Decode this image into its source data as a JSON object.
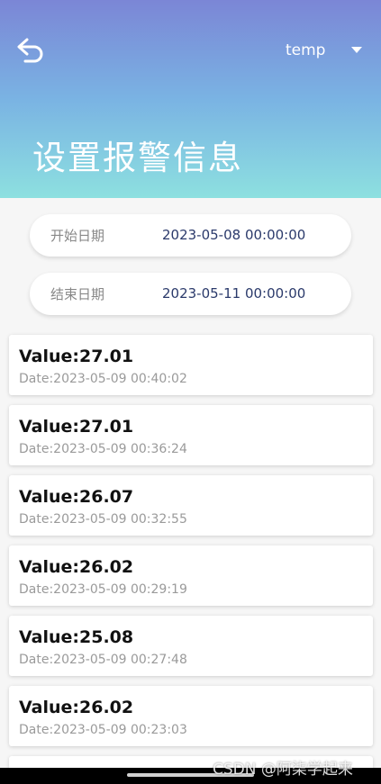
{
  "header": {
    "dropdown_value": "temp",
    "title": "设置报警信息"
  },
  "filters": {
    "start": {
      "label": "开始日期",
      "value": "2023-05-08 00:00:00"
    },
    "end": {
      "label": "结束日期",
      "value": "2023-05-11 00:00:00"
    }
  },
  "records": [
    {
      "value": "Value:27.01",
      "date": "Date:2023-05-09 00:40:02"
    },
    {
      "value": "Value:27.01",
      "date": "Date:2023-05-09 00:36:24"
    },
    {
      "value": "Value:26.07",
      "date": "Date:2023-05-09 00:32:55"
    },
    {
      "value": "Value:26.02",
      "date": "Date:2023-05-09 00:29:19"
    },
    {
      "value": "Value:25.08",
      "date": "Date:2023-05-09 00:27:48"
    },
    {
      "value": "Value:26.02",
      "date": "Date:2023-05-09 00:23:03"
    }
  ],
  "watermark": "CSDN @阿柒学起来",
  "icons": {
    "back": "back-arrow-icon",
    "dropdown": "caret-down-icon"
  },
  "colors": {
    "header_top": "#7b86d6",
    "header_bottom": "#8de0e0",
    "date_value": "#2b3a6b"
  }
}
